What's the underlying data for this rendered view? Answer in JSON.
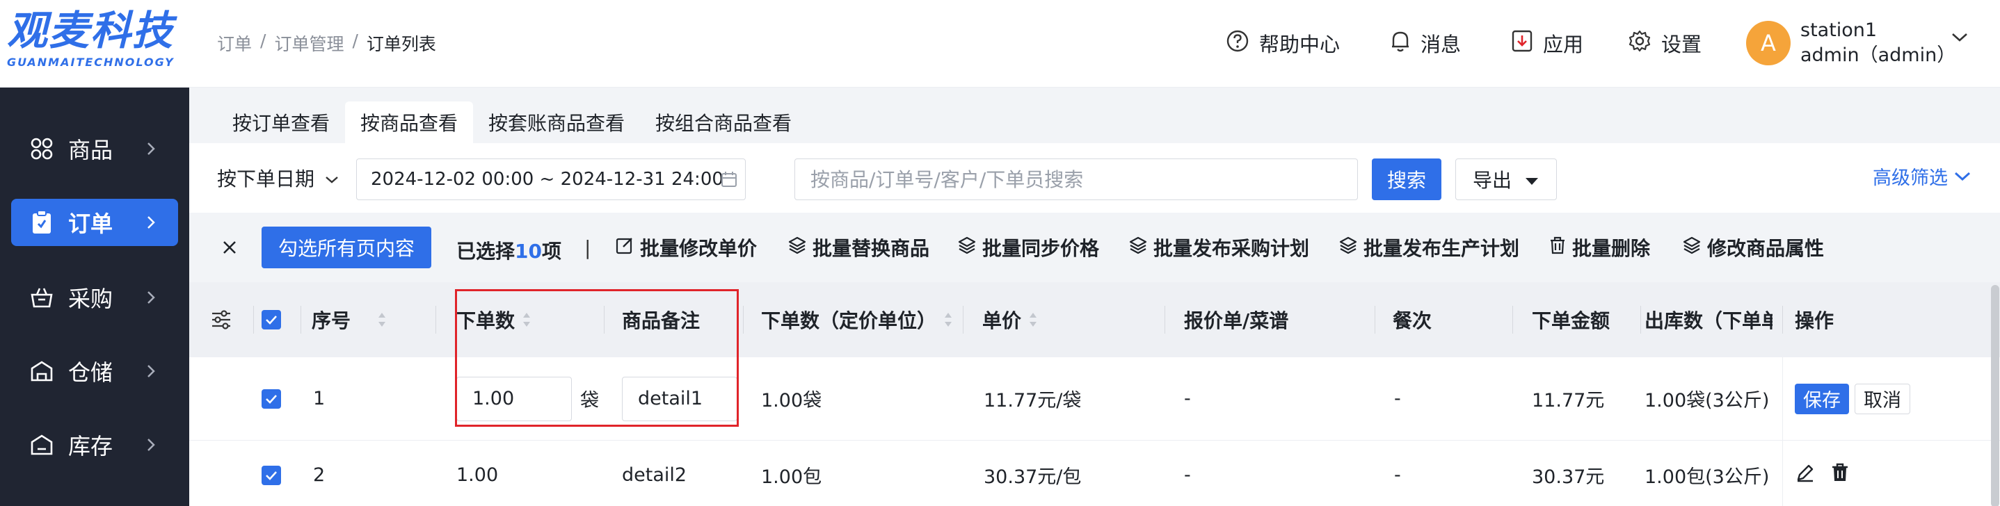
{
  "logo": {
    "title": "观麦科技",
    "subtitle": "GUANMAITECHNOLOGY",
    "brand_color": "#2f6fe8"
  },
  "sidebar": {
    "items": [
      {
        "label": "商品",
        "icon": "grid-icon",
        "active": false
      },
      {
        "label": "订单",
        "icon": "clipboard-icon",
        "active": true
      },
      {
        "label": "采购",
        "icon": "basket-icon",
        "active": false
      },
      {
        "label": "仓储",
        "icon": "warehouse-icon",
        "active": false
      },
      {
        "label": "库存",
        "icon": "inventory-icon",
        "active": false
      }
    ]
  },
  "breadcrumb": {
    "items": [
      "订单",
      "订单管理",
      "订单列表"
    ]
  },
  "header": {
    "help": "帮助中心",
    "messages": "消息",
    "apps": "应用",
    "settings": "设置",
    "avatar_letter": "A",
    "station": "station1",
    "user": "admin（admin）"
  },
  "tabs": [
    {
      "label": "按订单查看",
      "active": false
    },
    {
      "label": "按商品查看",
      "active": true
    },
    {
      "label": "按套账商品查看",
      "active": false
    },
    {
      "label": "按组合商品查看",
      "active": false
    }
  ],
  "filters": {
    "date_type": "按下单日期",
    "date_range": "2024-12-02 00:00 ~ 2024-12-31 24:00",
    "search_placeholder": "按商品/订单号/客户/下单员搜索",
    "search_value": "",
    "search_button": "搜索",
    "export_button": "导出",
    "advanced_filter": "高级筛选"
  },
  "batch": {
    "select_all_pages": "勾选所有页内容",
    "selected_prefix": "已选择",
    "selected_count": "10",
    "selected_suffix": "项",
    "separator": "|",
    "actions": [
      "批量修改单价",
      "批量替换商品",
      "批量同步价格",
      "批量发布采购计划",
      "批量发布生产计划",
      "批量删除",
      "修改商品属性"
    ]
  },
  "table": {
    "columns": [
      "序号",
      "下单数",
      "商品备注",
      "下单数（定价单位）",
      "单价",
      "报价单/菜谱",
      "餐次",
      "下单金额",
      "出库数（下单单位",
      "操作"
    ],
    "rows": [
      {
        "index": "1",
        "qty": "1.00",
        "unit": "袋",
        "remark": "detail1",
        "qty_pricing": "1.00袋",
        "price": "11.77元/袋",
        "quote": "-",
        "meal": "-",
        "amount": "11.77元",
        "outbound": "1.00袋(3公斤)",
        "editing": true,
        "save": "保存",
        "cancel": "取消"
      },
      {
        "index": "2",
        "qty": "1.00",
        "remark": "detail2",
        "qty_pricing": "1.00包",
        "price": "30.37元/包",
        "quote": "-",
        "meal": "-",
        "amount": "30.37元",
        "outbound": "1.00包(3公斤)",
        "editing": false
      }
    ]
  },
  "colors": {
    "primary": "#2f6fe8",
    "highlight_border": "#e0242a",
    "sidebar_bg": "#202532",
    "avatar": "#f5a43a"
  }
}
